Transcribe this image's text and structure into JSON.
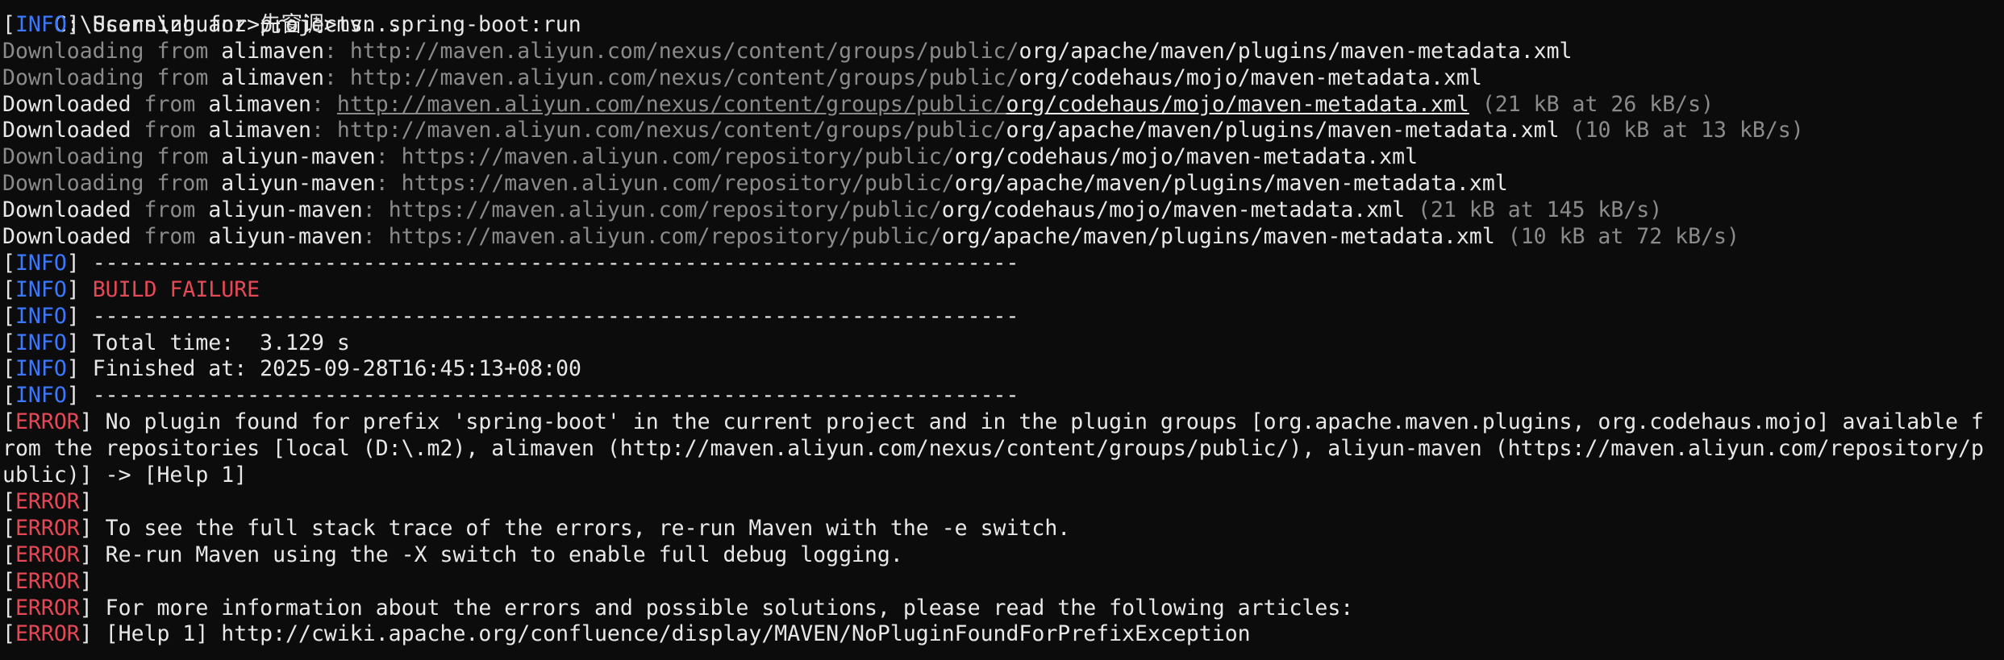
{
  "colors": {
    "background": "#0c0c0c",
    "text": "#e8e8e8",
    "dim": "#8b8b8b",
    "info": "#3b78ff",
    "error": "#e74856"
  },
  "prompt": {
    "text": "C:\\Users\\zhuanz>先窗调>mvn spring-boot:run"
  },
  "tags": {
    "info": "INFO",
    "error": "ERROR"
  },
  "scanning": "Scanning for projects...",
  "downloads": [
    {
      "verb": "Downloading",
      "from": "from",
      "repo": "alimaven",
      "base": "http://maven.aliyun.com/nexus/content/groups/public/",
      "path": "org/apache/maven/plugins/maven-metadata.xml",
      "size": ""
    },
    {
      "verb": "Downloading",
      "from": "from",
      "repo": "alimaven",
      "base": "http://maven.aliyun.com/nexus/content/groups/public/",
      "path": "org/codehaus/mojo/maven-metadata.xml",
      "size": ""
    },
    {
      "verb": "Downloaded",
      "from": "from",
      "repo": "alimaven",
      "base": "http://maven.aliyun.com/nexus/content/groups/public/",
      "path": "org/codehaus/mojo/maven-metadata.xml",
      "size": "(21 kB at 26 kB/s)"
    },
    {
      "verb": "Downloaded",
      "from": "from",
      "repo": "alimaven",
      "base": "http://maven.aliyun.com/nexus/content/groups/public/",
      "path": "org/apache/maven/plugins/maven-metadata.xml",
      "size": "(10 kB at 13 kB/s)"
    },
    {
      "verb": "Downloading",
      "from": "from",
      "repo": "aliyun-maven",
      "base": "https://maven.aliyun.com/repository/public/",
      "path": "org/codehaus/mojo/maven-metadata.xml",
      "size": ""
    },
    {
      "verb": "Downloading",
      "from": "from",
      "repo": "aliyun-maven",
      "base": "https://maven.aliyun.com/repository/public/",
      "path": "org/apache/maven/plugins/maven-metadata.xml",
      "size": ""
    },
    {
      "verb": "Downloaded",
      "from": "from",
      "repo": "aliyun-maven",
      "base": "https://maven.aliyun.com/repository/public/",
      "path": "org/codehaus/mojo/maven-metadata.xml",
      "size": "(21 kB at 145 kB/s)"
    },
    {
      "verb": "Downloaded",
      "from": "from",
      "repo": "aliyun-maven",
      "base": "https://maven.aliyun.com/repository/public/",
      "path": "org/apache/maven/plugins/maven-metadata.xml",
      "size": "(10 kB at 72 kB/s)"
    }
  ],
  "separator": "------------------------------------------------------------------------",
  "build_failure": "BUILD FAILURE",
  "total_time": "Total time:  3.129 s",
  "finished_at": "Finished at: 2025-09-28T16:45:13+08:00",
  "errors": {
    "no_plugin": " No plugin found for prefix 'spring-boot' in the current project and in the plugin groups [org.apache.maven.plugins, org.codehaus.mojo] available f\nrom the repositories [local (D:\\.m2), alimaven (http://maven.aliyun.com/nexus/content/groups/public/), aliyun-maven (https://maven.aliyun.com/repository/p\nublic)] -> [Help 1]",
    "stack_trace": " To see the full stack trace of the errors, re-run Maven with the -e switch.",
    "debug": " Re-run Maven using the -X switch to enable full debug logging.",
    "more_info": " For more information about the errors and possible solutions, please read the following articles:",
    "help_link": " [Help 1] http://cwiki.apache.org/confluence/display/MAVEN/NoPluginFoundForPrefixException"
  }
}
